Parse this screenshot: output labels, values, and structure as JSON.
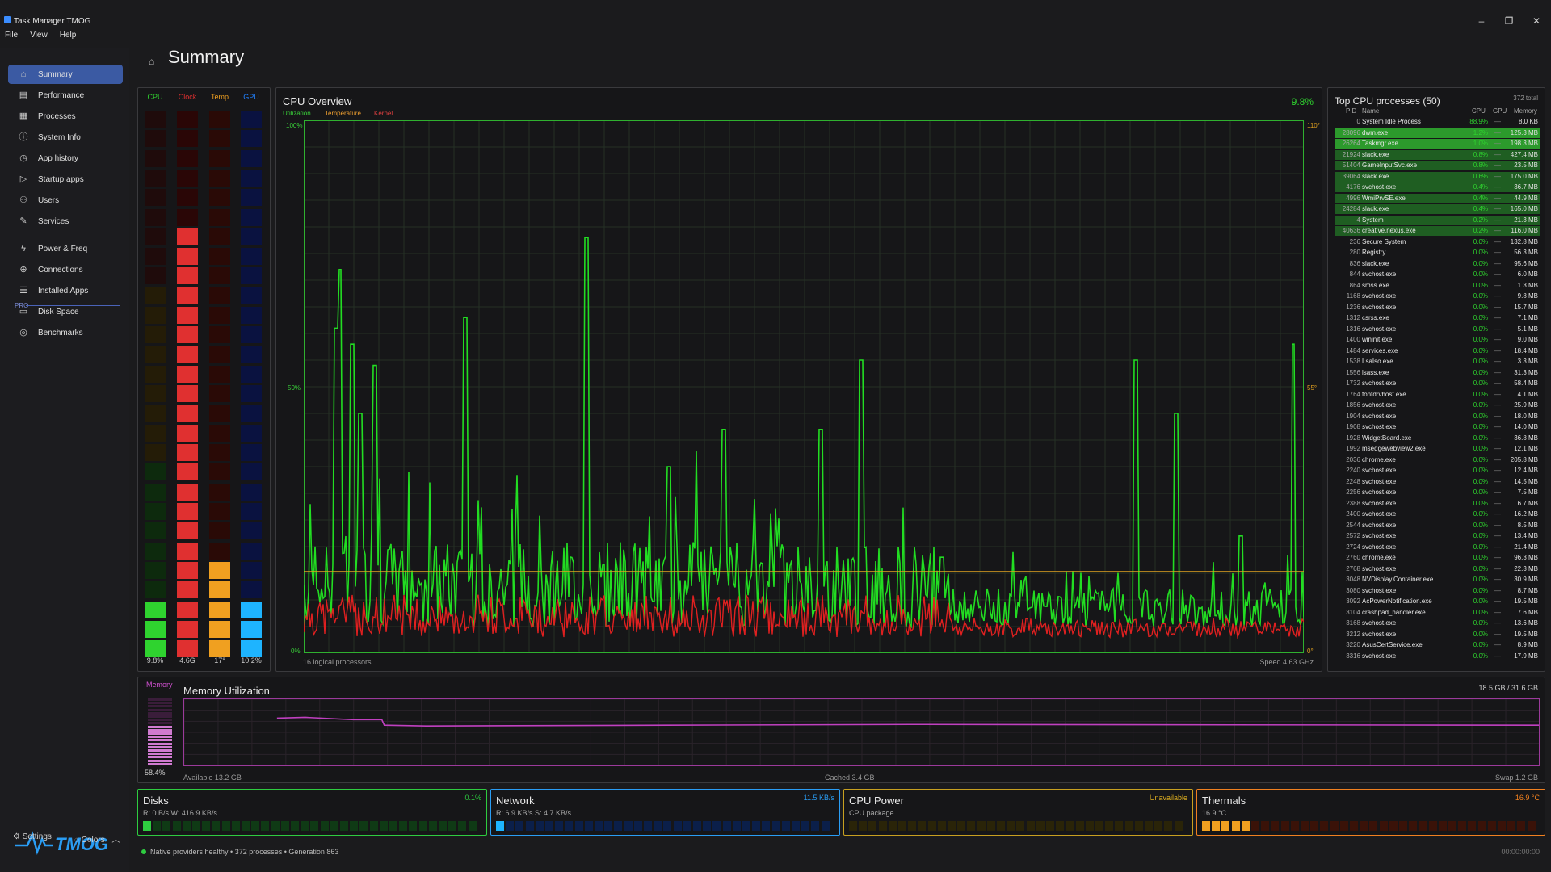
{
  "window": {
    "title": "Task Manager TMOG"
  },
  "menu": [
    "File",
    "View",
    "Help"
  ],
  "window_buttons": {
    "minimize": "–",
    "restore": "❐",
    "close": "✕"
  },
  "sidebar": {
    "items": [
      {
        "label": "Summary",
        "icon": "home-icon",
        "glyph": "⌂"
      },
      {
        "label": "Performance",
        "icon": "chart-icon",
        "glyph": "▤"
      },
      {
        "label": "Processes",
        "icon": "grid-icon",
        "glyph": "▦"
      },
      {
        "label": "System Info",
        "icon": "info-icon",
        "glyph": "ⓘ"
      },
      {
        "label": "App history",
        "icon": "clock-icon",
        "glyph": "◷"
      },
      {
        "label": "Startup apps",
        "icon": "play-icon",
        "glyph": "▷"
      },
      {
        "label": "Users",
        "icon": "users-icon",
        "glyph": "⚇"
      },
      {
        "label": "Services",
        "icon": "wrench-icon",
        "glyph": "✎"
      },
      {
        "label": "Power & Freq",
        "icon": "bolt-icon",
        "glyph": "ϟ"
      },
      {
        "label": "Connections",
        "icon": "globe-icon",
        "glyph": "⊕"
      },
      {
        "label": "Installed Apps",
        "icon": "list-icon",
        "glyph": "☰"
      },
      {
        "label": "Disk Space",
        "icon": "disk-icon",
        "glyph": "▭"
      },
      {
        "label": "Benchmarks",
        "icon": "gauge-icon",
        "glyph": "◎"
      }
    ],
    "pro_label": "PRO",
    "logo_text": "TMOG",
    "settings_label": "Settings",
    "colors_label": "Colors"
  },
  "page": {
    "title": "Summary"
  },
  "meters": {
    "headers": [
      {
        "label": "CPU",
        "color": "#2fd32f"
      },
      {
        "label": "Clock",
        "color": "#e03030"
      },
      {
        "label": "Temp",
        "color": "#f0a020"
      },
      {
        "label": "GPU",
        "color": "#2080ff"
      }
    ],
    "values": [
      "9.8%",
      "4.6G",
      "17°",
      "10.2%"
    ],
    "levels": [
      0.1,
      0.78,
      0.17,
      0.1
    ]
  },
  "cpu": {
    "title": "CPU Overview",
    "current": "9.8%",
    "legend": {
      "utilization": "Utilization",
      "temperature": "Temperature",
      "kernel": "Kernel"
    },
    "axis_left": {
      "top": "100%",
      "mid": "50%",
      "bottom": "0%"
    },
    "axis_right": {
      "top": "110°",
      "mid": "55°",
      "bottom": "0°"
    },
    "footer_left": "16 logical processors",
    "footer_right": "Speed 4.63 GHz",
    "colors": {
      "utilization": "#22dd22",
      "kernel": "#e02020",
      "temperature": "#e0a020"
    }
  },
  "processes": {
    "title": "Top CPU processes (50)",
    "total": "372 total",
    "columns": [
      "PID",
      "Name",
      "CPU",
      "GPU",
      "Memory"
    ],
    "rows": [
      [
        "0",
        "System Idle Process",
        "88.9%",
        "—",
        "8.0 KB"
      ],
      [
        "28096",
        "dwm.exe",
        "1.2%",
        "—",
        "125.3 MB"
      ],
      [
        "26264",
        "Taskmgr.exe",
        "1.0%",
        "—",
        "198.3 MB"
      ],
      [
        "21924",
        "slack.exe",
        "0.8%",
        "—",
        "427.4 MB"
      ],
      [
        "51404",
        "GameInputSvc.exe",
        "0.8%",
        "—",
        "23.5 MB"
      ],
      [
        "39064",
        "slack.exe",
        "0.6%",
        "—",
        "175.0 MB"
      ],
      [
        "4176",
        "svchost.exe",
        "0.4%",
        "—",
        "36.7 MB"
      ],
      [
        "4996",
        "WmiPrvSE.exe",
        "0.4%",
        "—",
        "44.9 MB"
      ],
      [
        "24284",
        "slack.exe",
        "0.4%",
        "—",
        "165.0 MB"
      ],
      [
        "4",
        "System",
        "0.2%",
        "—",
        "21.3 MB"
      ],
      [
        "40636",
        "creative.nexus.exe",
        "0.2%",
        "—",
        "116.0 MB"
      ],
      [
        "236",
        "Secure System",
        "0.0%",
        "—",
        "132.8 MB"
      ],
      [
        "280",
        "Registry",
        "0.0%",
        "—",
        "56.3 MB"
      ],
      [
        "836",
        "slack.exe",
        "0.0%",
        "—",
        "95.6 MB"
      ],
      [
        "844",
        "svchost.exe",
        "0.0%",
        "—",
        "6.0 MB"
      ],
      [
        "864",
        "smss.exe",
        "0.0%",
        "—",
        "1.3 MB"
      ],
      [
        "1168",
        "svchost.exe",
        "0.0%",
        "—",
        "9.8 MB"
      ],
      [
        "1236",
        "svchost.exe",
        "0.0%",
        "—",
        "15.7 MB"
      ],
      [
        "1312",
        "csrss.exe",
        "0.0%",
        "—",
        "7.1 MB"
      ],
      [
        "1316",
        "svchost.exe",
        "0.0%",
        "—",
        "5.1 MB"
      ],
      [
        "1400",
        "wininit.exe",
        "0.0%",
        "—",
        "9.0 MB"
      ],
      [
        "1484",
        "services.exe",
        "0.0%",
        "—",
        "18.4 MB"
      ],
      [
        "1538",
        "LsaIso.exe",
        "0.0%",
        "—",
        "3.3 MB"
      ],
      [
        "1556",
        "lsass.exe",
        "0.0%",
        "—",
        "31.3 MB"
      ],
      [
        "1732",
        "svchost.exe",
        "0.0%",
        "—",
        "58.4 MB"
      ],
      [
        "1764",
        "fontdrvhost.exe",
        "0.0%",
        "—",
        "4.1 MB"
      ],
      [
        "1856",
        "svchost.exe",
        "0.0%",
        "—",
        "25.9 MB"
      ],
      [
        "1904",
        "svchost.exe",
        "0.0%",
        "—",
        "18.0 MB"
      ],
      [
        "1908",
        "svchost.exe",
        "0.0%",
        "—",
        "14.0 MB"
      ],
      [
        "1928",
        "WidgetBoard.exe",
        "0.0%",
        "—",
        "36.8 MB"
      ],
      [
        "1992",
        "msedgewebview2.exe",
        "0.0%",
        "—",
        "12.1 MB"
      ],
      [
        "2036",
        "chrome.exe",
        "0.0%",
        "—",
        "205.8 MB"
      ],
      [
        "2240",
        "svchost.exe",
        "0.0%",
        "—",
        "12.4 MB"
      ],
      [
        "2248",
        "svchost.exe",
        "0.0%",
        "—",
        "14.5 MB"
      ],
      [
        "2256",
        "svchost.exe",
        "0.0%",
        "—",
        "7.5 MB"
      ],
      [
        "2388",
        "svchost.exe",
        "0.0%",
        "—",
        "6.7 MB"
      ],
      [
        "2400",
        "svchost.exe",
        "0.0%",
        "—",
        "16.2 MB"
      ],
      [
        "2544",
        "svchost.exe",
        "0.0%",
        "—",
        "8.5 MB"
      ],
      [
        "2572",
        "svchost.exe",
        "0.0%",
        "—",
        "13.4 MB"
      ],
      [
        "2724",
        "svchost.exe",
        "0.0%",
        "—",
        "21.4 MB"
      ],
      [
        "2760",
        "chrome.exe",
        "0.0%",
        "—",
        "96.3 MB"
      ],
      [
        "2768",
        "svchost.exe",
        "0.0%",
        "—",
        "22.3 MB"
      ],
      [
        "3048",
        "NVDisplay.Container.exe",
        "0.0%",
        "—",
        "30.9 MB"
      ],
      [
        "3080",
        "svchost.exe",
        "0.0%",
        "—",
        "8.7 MB"
      ],
      [
        "3092",
        "AcPowerNotification.exe",
        "0.0%",
        "—",
        "19.5 MB"
      ],
      [
        "3104",
        "crashpad_handler.exe",
        "0.0%",
        "—",
        "7.6 MB"
      ],
      [
        "3168",
        "svchost.exe",
        "0.0%",
        "—",
        "13.6 MB"
      ],
      [
        "3212",
        "svchost.exe",
        "0.0%",
        "—",
        "19.5 MB"
      ],
      [
        "3220",
        "AsusCertService.exe",
        "0.0%",
        "—",
        "8.9 MB"
      ],
      [
        "3316",
        "svchost.exe",
        "0.0%",
        "—",
        "17.9 MB"
      ]
    ],
    "highlighted_count": 11
  },
  "memory": {
    "label": "Memory",
    "title": "Memory Utilization",
    "total": "18.5 GB / 31.6 GB",
    "percent": "58.4%",
    "level": 0.584,
    "available": "Available 13.2 GB",
    "cached": "Cached 3.4 GB",
    "swap": "Swap 1.2 GB",
    "color": "#c040c0"
  },
  "tiles": [
    {
      "title": "Disks",
      "value": "0.1%",
      "sub": "R: 0 B/s  W: 416.9 KB/s",
      "color": "#2ecc40",
      "fill": 0.03
    },
    {
      "title": "Network",
      "value": "11.5 KB/s",
      "sub": "R: 6.9 KB/s  S: 4.7 KB/s",
      "color": "#2a9df4",
      "fill": 0.03
    },
    {
      "title": "CPU Power",
      "value": "Unavailable",
      "sub": "CPU package",
      "color": "#e0b020",
      "fill": 0.0
    },
    {
      "title": "Thermals",
      "value": "16.9 °C",
      "sub": "16.9 °C",
      "color": "#f08020",
      "fill": 0.15
    }
  ],
  "status": {
    "text": "Native providers healthy  •  372 processes  •  Generation 863",
    "right": "00:00:00:00"
  }
}
